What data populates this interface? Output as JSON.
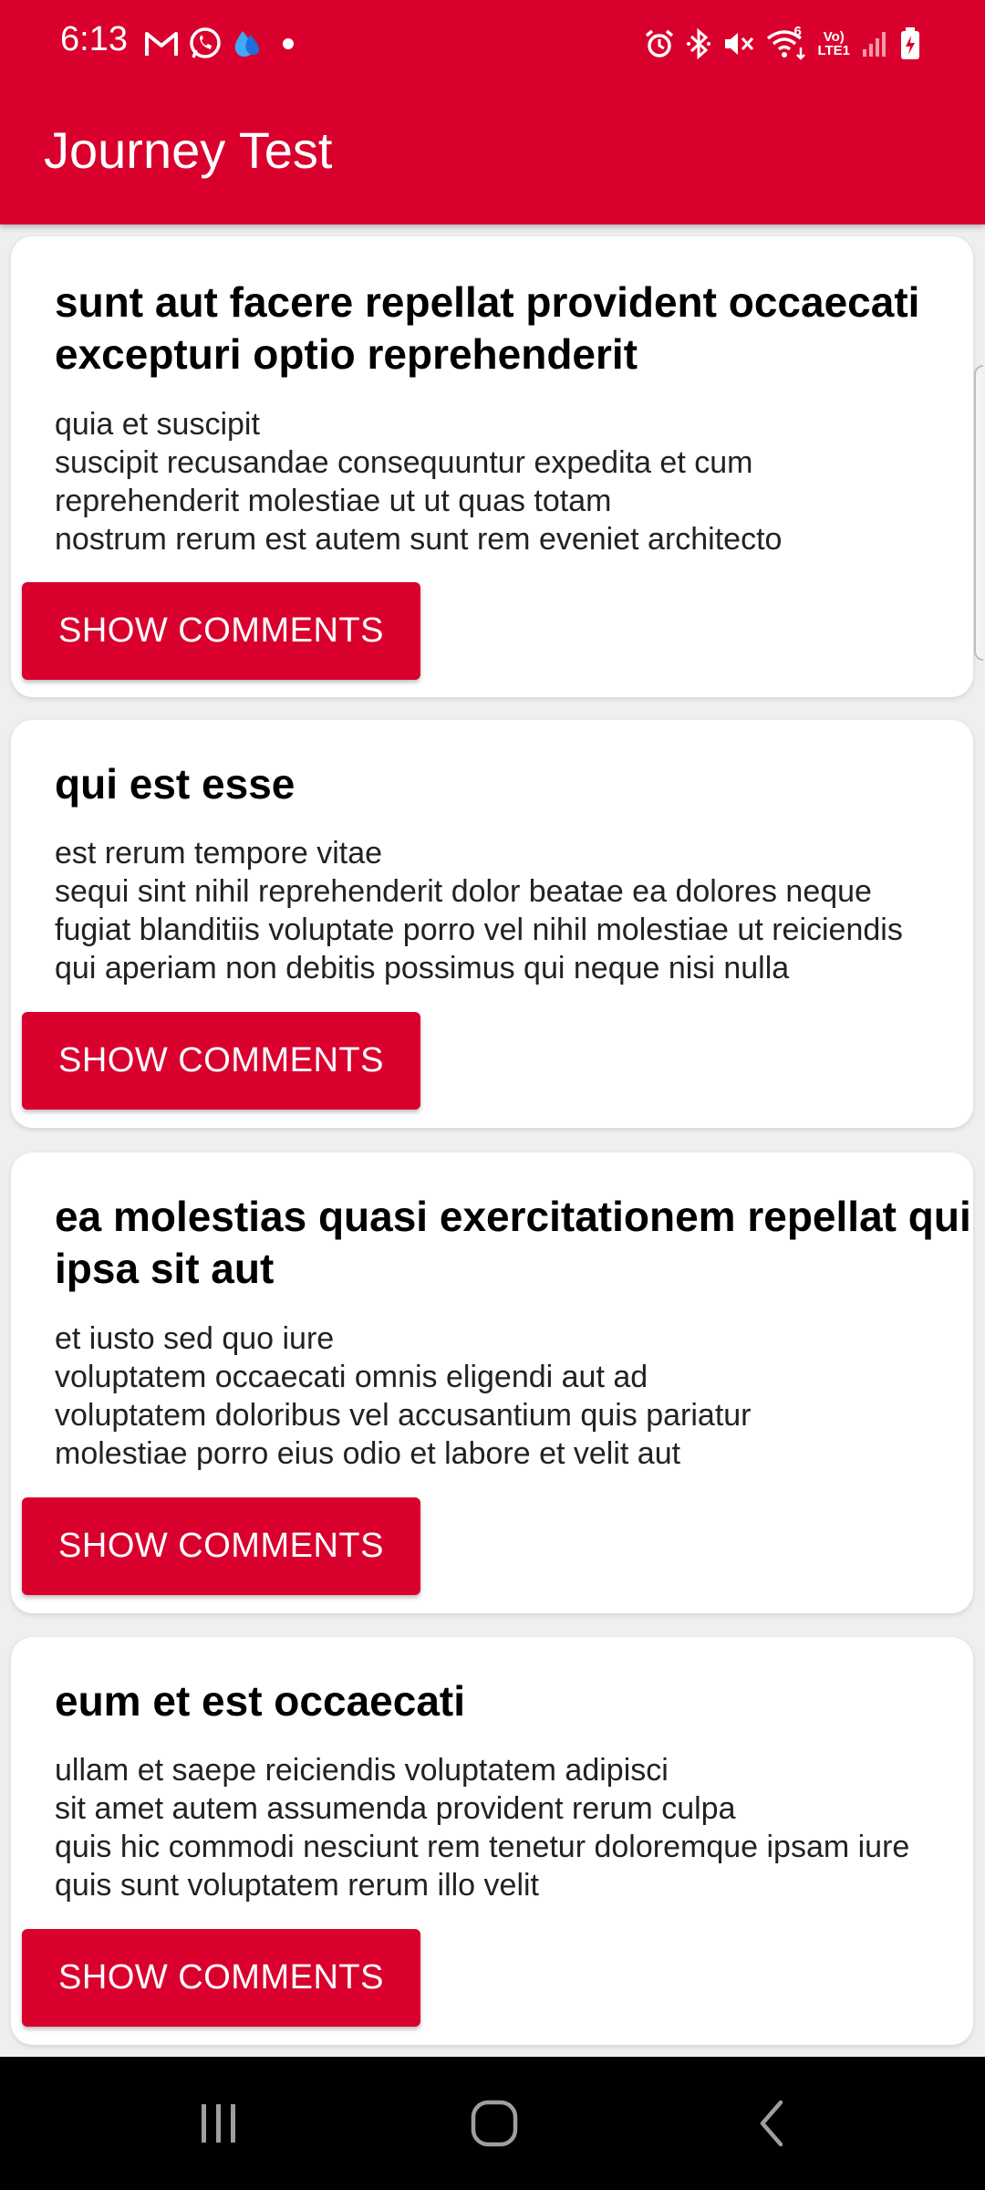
{
  "status_bar": {
    "time": "6:13",
    "left_icons": [
      "gmail-icon",
      "whatsapp-icon",
      "drop-icon",
      "dot-icon"
    ],
    "right_icons": [
      "alarm-icon",
      "bluetooth-icon",
      "mute-icon",
      "wifi-icon",
      "volte-icon",
      "signal-icon",
      "battery-icon"
    ],
    "volte_label": "Vo)\nLTE1",
    "wifi_label": "6"
  },
  "app_bar": {
    "title": "Journey Test"
  },
  "posts": [
    {
      "title": "sunt aut facere repellat provident occaecati\nexcepturi optio reprehenderit",
      "body": "quia et suscipit\nsuscipit recusandae consequuntur expedita et cum\nreprehenderit molestiae ut ut quas totam\nnostrum rerum est autem sunt rem eveniet architecto",
      "button": "SHOW COMMENTS"
    },
    {
      "title": "qui est esse",
      "body": "est rerum tempore vitae\nsequi sint nihil reprehenderit dolor beatae ea dolores neque\nfugiat blanditiis voluptate porro vel nihil molestiae ut reiciendis\nqui aperiam non debitis possimus qui neque nisi nulla",
      "button": "SHOW COMMENTS"
    },
    {
      "title": "ea molestias quasi exercitationem repellat qui\nipsa sit aut",
      "body": "et iusto sed quo iure\nvoluptatem occaecati omnis eligendi aut ad\nvoluptatem doloribus vel accusantium quis pariatur\nmolestiae porro eius odio et labore et velit aut",
      "button": "SHOW COMMENTS"
    },
    {
      "title": "eum et est occaecati",
      "body": "ullam et saepe reiciendis voluptatem adipisci\nsit amet autem assumenda provident rerum culpa\nquis hic commodi nesciunt rem tenetur doloremque ipsam iure\nquis sunt voluptatem rerum illo velit",
      "button": "SHOW COMMENTS"
    }
  ],
  "colors": {
    "primary": "#d9002e",
    "background": "#efefef",
    "card": "#ffffff",
    "nav": "#000000"
  },
  "nav_bar": {
    "buttons": [
      "recents-icon",
      "home-icon",
      "back-icon"
    ]
  }
}
